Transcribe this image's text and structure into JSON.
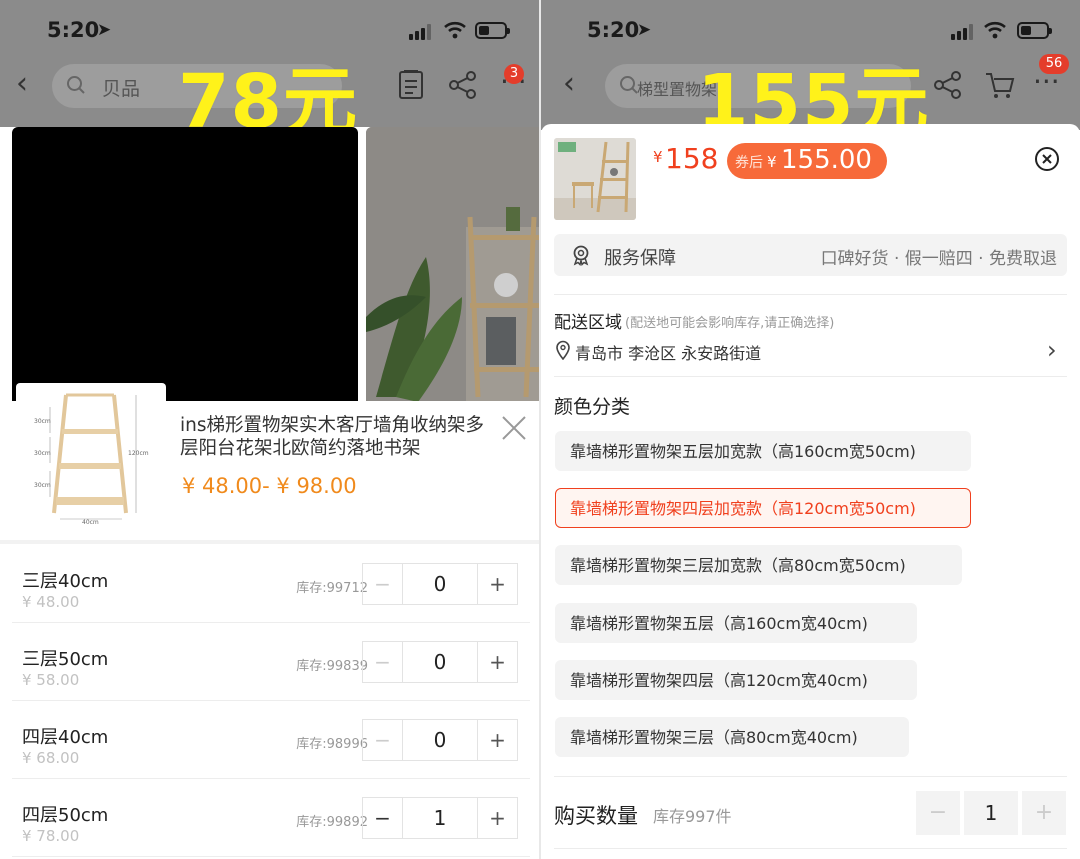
{
  "left": {
    "status_time": "5:20",
    "search_text": "贝品",
    "cart_badge": "3",
    "overlay_price": "78元",
    "product_name": "ins梯形置物架实木客厅墙角收纳架多层阳台花架北欧简约落地书架",
    "price_range": "¥ 48.00- ¥ 98.00",
    "thumb_dims": {
      "h1": "30cm",
      "h2": "30cm",
      "h3": "30cm",
      "total": "120cm",
      "width": "40cm"
    },
    "variants": [
      {
        "name": "三层40cm",
        "price": "¥ 48.00",
        "stock": "库存:99712",
        "qty": "0"
      },
      {
        "name": "三层50cm",
        "price": "¥ 58.00",
        "stock": "库存:99839",
        "qty": "0"
      },
      {
        "name": "四层40cm",
        "price": "¥ 68.00",
        "stock": "库存:98996",
        "qty": "0"
      },
      {
        "name": "四层50cm",
        "price": "¥ 78.00",
        "stock": "库存:99892",
        "qty": "1"
      }
    ],
    "minus": "−",
    "plus": "+"
  },
  "right": {
    "status_time": "5:20",
    "search_text": "梯型置物架",
    "cart_badge": "56",
    "overlay_price": "155元",
    "price_currency": "¥",
    "price": "158",
    "coupon_label": "券后",
    "coupon_currency": "¥",
    "coupon_price": "155.00",
    "service_title": "服务保障",
    "service_desc": "口碑好货 · 假一赔四 · 免费取退",
    "delivery_title": "配送区域",
    "delivery_note": "(配送地可能会影响库存,请正确选择)",
    "address": "青岛市 李沧区 永安路街道",
    "color_title": "颜色分类",
    "color_options": [
      "靠墙梯形置物架五层加宽款（高160cm宽50cm)",
      "靠墙梯形置物架四层加宽款（高120cm宽50cm)",
      "靠墙梯形置物架三层加宽款（高80cm宽50cm)",
      "靠墙梯形置物架五层（高160cm宽40cm)",
      "靠墙梯形置物架四层（高120cm宽40cm)",
      "靠墙梯形置物架三层（高80cm宽40cm)"
    ],
    "selected_color_index": 1,
    "qty_title": "购买数量",
    "qty_stock": "库存997件",
    "qty": "1",
    "minus": "−",
    "plus": "+"
  },
  "colors": {
    "overlay_yellow": "#fff21a",
    "accent_orange": "#f0401e",
    "range_orange": "#f08a1c"
  }
}
